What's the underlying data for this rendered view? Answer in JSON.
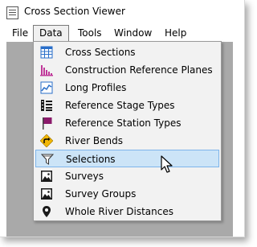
{
  "window": {
    "title": "Cross Section Viewer"
  },
  "menubar": {
    "items": [
      {
        "label": "File"
      },
      {
        "label": "Data"
      },
      {
        "label": "Tools"
      },
      {
        "label": "Window"
      },
      {
        "label": "Help"
      }
    ]
  },
  "data_menu": {
    "items": [
      {
        "label": "Cross Sections",
        "icon": "grid-table-icon"
      },
      {
        "label": "Construction Reference Planes",
        "icon": "bars-icon"
      },
      {
        "label": "Long Profiles",
        "icon": "line-profile-icon"
      },
      {
        "label": "Reference Stage Types",
        "icon": "stage-list-icon"
      },
      {
        "label": "Reference Station Types",
        "icon": "flag-icon"
      },
      {
        "label": "River Bends",
        "icon": "river-bend-sign-icon"
      },
      {
        "label": "Selections",
        "icon": "filter-icon",
        "highlighted": true
      },
      {
        "label": "Surveys",
        "icon": "image-icon"
      },
      {
        "label": "Survey Groups",
        "icon": "image-icon"
      },
      {
        "label": "Whole River Distances",
        "icon": "map-pin-icon"
      }
    ]
  },
  "colors": {
    "highlight_bg": "#cce4f7",
    "highlight_border": "#7eb4ea",
    "workspace": "#a9a9a9",
    "flag": "#8b1a6b",
    "river_sign": "#f2b705"
  }
}
